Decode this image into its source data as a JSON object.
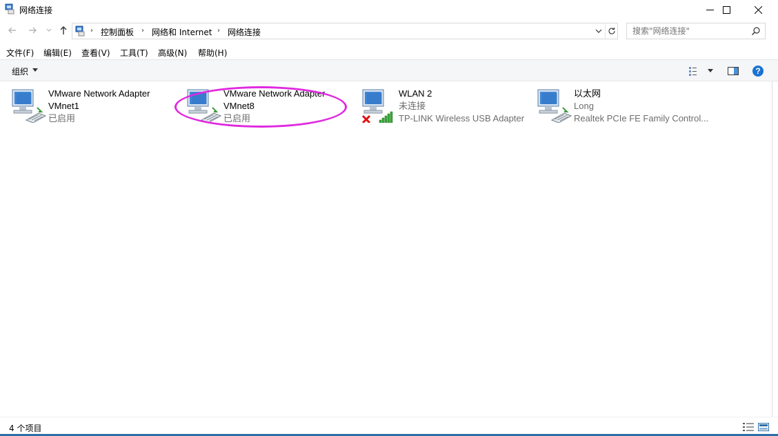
{
  "window": {
    "title": "网络连接",
    "minimize_icon": "minimize-icon",
    "maximize_icon": "maximize-icon",
    "close_icon": "close-icon"
  },
  "address": {
    "crumbs": [
      "控制面板",
      "网络和 Internet",
      "网络连接"
    ],
    "search_placeholder": "搜索\"网络连接\""
  },
  "menu": {
    "items": [
      "文件(F)",
      "编辑(E)",
      "查看(V)",
      "工具(T)",
      "高级(N)",
      "帮助(H)"
    ]
  },
  "toolbar": {
    "organize_label": "组织"
  },
  "adapters": [
    {
      "name": "VMware Network Adapter",
      "device": "VMnet1",
      "status": "已启用",
      "type": "wired"
    },
    {
      "name": "VMware Network Adapter",
      "device": "VMnet8",
      "status": "已启用",
      "type": "wired",
      "highlighted": true
    },
    {
      "name": "WLAN 2",
      "device": "未连接",
      "status": "TP-LINK Wireless USB Adapter",
      "type": "wireless-disconnected"
    },
    {
      "name": "以太网",
      "device": "Long",
      "status": "Realtek PCIe FE Family Control...",
      "type": "wired"
    }
  ],
  "statusbar": {
    "count": "4 个项目"
  },
  "colors": {
    "highlight": "#e029e0",
    "accent": "#2d6ea6",
    "help": "#1a73d0"
  }
}
